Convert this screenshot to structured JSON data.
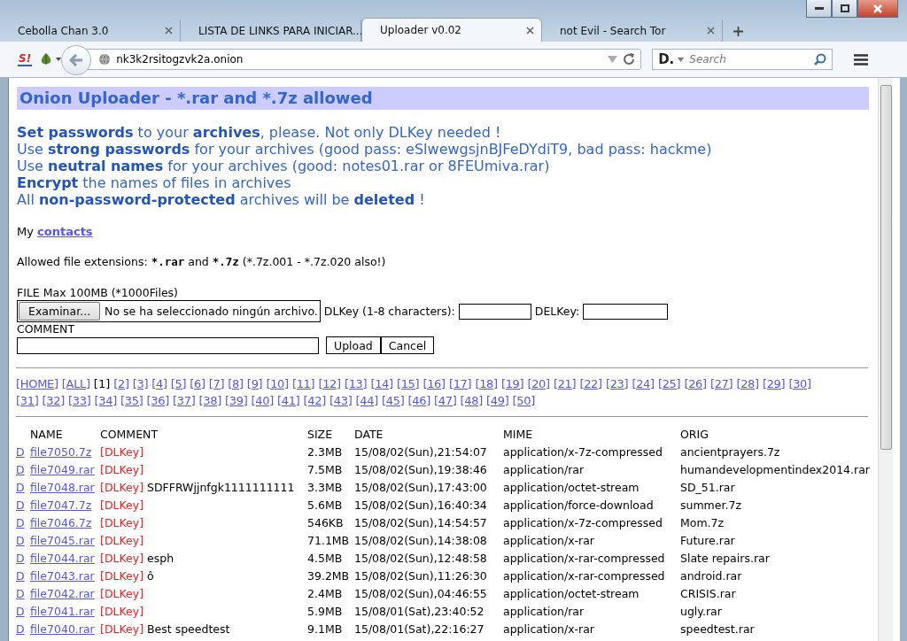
{
  "tabs": [
    {
      "label": "Cebolla Chan 3.0",
      "selected": false
    },
    {
      "label": "LISTA DE LINKS PARA INICIAR...",
      "selected": false
    },
    {
      "label": "Uploader v0.02",
      "selected": true
    },
    {
      "label": "not Evil - Search Tor",
      "selected": false
    }
  ],
  "toolbar": {
    "script_button": "S!",
    "url": "nk3k2rsitogzvk2a.onion",
    "search_engine": "D.",
    "search_placeholder": "Search"
  },
  "page": {
    "title": "Onion Uploader - *.rar and *.7z allowed",
    "notes": [
      "**Set passwords** to your **archives**, please. Not only DLKey needed !",
      "Use **strong passwords** for your archives (good pass: eSlwewgsjnBJFeDYdiT9, bad pass: hackme)",
      "Use **neutral names** for your archives (good: notes01.rar or 8FEUmiva.rar)",
      "**Encrypt** the names of files in archives",
      "All **non-password-protected** archives will be **deleted** !"
    ],
    "contacts": {
      "prefix": "My",
      "link": "contacts"
    },
    "extensions": [
      {
        "text": "Allowed file extensions: ",
        "bold": false
      },
      {
        "text": "*.rar",
        "bold": true
      },
      {
        "text": " and ",
        "bold": false
      },
      {
        "text": "*.7z",
        "bold": true
      },
      {
        "text": " (*.7z.001 - *.7z.020 also!)",
        "bold": false
      }
    ],
    "form": {
      "file_label": "FILE Max 100MB (*1000Files)",
      "browse_button": "Examinar...",
      "file_status": "No se ha seleccionado ningún archivo.",
      "dlkey_label": "DLKey (1-8 characters):",
      "delkey_label": "DELKey:",
      "comment_label": "COMMENT",
      "buttons": [
        "Upload",
        "Cancel"
      ]
    },
    "pager": [
      [
        {
          "label": "[HOME]",
          "selected": false
        },
        {
          "label": "[ALL]",
          "selected": false
        },
        {
          "label": "[1]",
          "selected": true
        },
        {
          "label": "[2]",
          "selected": false
        },
        {
          "label": "[3]",
          "selected": false
        },
        {
          "label": "[4]",
          "selected": false
        },
        {
          "label": "[5]",
          "selected": false
        },
        {
          "label": "[6]",
          "selected": false
        },
        {
          "label": "[7]",
          "selected": false
        },
        {
          "label": "[8]",
          "selected": false
        },
        {
          "label": "[9]",
          "selected": false
        },
        {
          "label": "[10]",
          "selected": false
        },
        {
          "label": "[11]",
          "selected": false
        },
        {
          "label": "[12]",
          "selected": false
        },
        {
          "label": "[13]",
          "selected": false
        },
        {
          "label": "[14]",
          "selected": false
        },
        {
          "label": "[15]",
          "selected": false
        },
        {
          "label": "[16]",
          "selected": false
        },
        {
          "label": "[17]",
          "selected": false
        },
        {
          "label": "[18]",
          "selected": false
        },
        {
          "label": "[19]",
          "selected": false
        },
        {
          "label": "[20]",
          "selected": false
        },
        {
          "label": "[21]",
          "selected": false
        },
        {
          "label": "[22]",
          "selected": false
        },
        {
          "label": "[23]",
          "selected": false
        },
        {
          "label": "[24]",
          "selected": false
        },
        {
          "label": "[25]",
          "selected": false
        },
        {
          "label": "[26]",
          "selected": false
        },
        {
          "label": "[27]",
          "selected": false
        },
        {
          "label": "[28]",
          "selected": false
        },
        {
          "label": "[29]",
          "selected": false
        },
        {
          "label": "[30]",
          "selected": false
        }
      ],
      [
        {
          "label": "[31]",
          "selected": false
        },
        {
          "label": "[32]",
          "selected": false
        },
        {
          "label": "[33]",
          "selected": false
        },
        {
          "label": "[34]",
          "selected": false
        },
        {
          "label": "[35]",
          "selected": false
        },
        {
          "label": "[36]",
          "selected": false
        },
        {
          "label": "[37]",
          "selected": false
        },
        {
          "label": "[38]",
          "selected": false
        },
        {
          "label": "[39]",
          "selected": false
        },
        {
          "label": "[40]",
          "selected": false
        },
        {
          "label": "[41]",
          "selected": false
        },
        {
          "label": "[42]",
          "selected": false
        },
        {
          "label": "[43]",
          "selected": false
        },
        {
          "label": "[44]",
          "selected": false
        },
        {
          "label": "[45]",
          "selected": false
        },
        {
          "label": "[46]",
          "selected": false
        },
        {
          "label": "[47]",
          "selected": false
        },
        {
          "label": "[48]",
          "selected": false
        },
        {
          "label": "[49]",
          "selected": false
        },
        {
          "label": "[50]",
          "selected": false
        }
      ]
    ],
    "table": {
      "columns": [
        "NAME",
        "COMMENT",
        "SIZE",
        "DATE",
        "MIME",
        "ORIG"
      ],
      "rows": [
        {
          "d": "D",
          "name": "file7050.7z",
          "key": "[DLKey]",
          "size": "2.3MB",
          "date": "15/08/02(Sun),21:54:07",
          "mime": "application/x-7z-compressed",
          "orig": "ancientprayers.7z"
        },
        {
          "d": "D",
          "name": "file7049.rar",
          "key": "[DLKey]",
          "size": "7.5MB",
          "date": "15/08/02(Sun),19:38:46",
          "mime": "application/rar",
          "orig": "humandevelopmentindex2014.rar"
        },
        {
          "d": "D",
          "name": "file7048.rar",
          "key": "[DLKey]",
          "comment": "SDFFRWjjnfgk1111111111",
          "size": "3.3MB",
          "date": "15/08/02(Sun),17:43:00",
          "mime": "application/octet-stream",
          "orig": "SD_51.rar"
        },
        {
          "d": "D",
          "name": "file7047.7z",
          "key": "[DLKey]",
          "size": "5.6MB",
          "date": "15/08/02(Sun),16:40:34",
          "mime": "application/force-download",
          "orig": "summer.7z"
        },
        {
          "d": "D",
          "name": "file7046.7z",
          "key": "[DLKey]",
          "size": "546KB",
          "date": "15/08/02(Sun),14:54:57",
          "mime": "application/x-7z-compressed",
          "orig": "Mom.7z"
        },
        {
          "d": "D",
          "name": "file7045.rar",
          "key": "[DLKey]",
          "size": "71.1MB",
          "date": "15/08/02(Sun),14:38:08",
          "mime": "application/x-rar",
          "orig": "Future.rar"
        },
        {
          "d": "D",
          "name": "file7044.rar",
          "key": "[DLKey]",
          "comment": "esph",
          "size": "4.5MB",
          "date": "15/08/02(Sun),12:48:58",
          "mime": "application/x-rar-compressed",
          "orig": "Slate repairs.rar"
        },
        {
          "d": "D",
          "name": "file7043.rar",
          "key": "[DLKey]",
          "comment": "ô",
          "size": "39.2MB",
          "date": "15/08/02(Sun),11:26:30",
          "mime": "application/x-rar-compressed",
          "orig": "android.rar"
        },
        {
          "d": "D",
          "name": "file7042.rar",
          "key": "[DLKey]",
          "size": "2.4MB",
          "date": "15/08/02(Sun),04:46:55",
          "mime": "application/octet-stream",
          "orig": "CRISIS.rar"
        },
        {
          "d": "D",
          "name": "file7041.rar",
          "key": "[DLKey]",
          "size": "5.9MB",
          "date": "15/08/01(Sat),23:40:52",
          "mime": "application/rar",
          "orig": "ugly.rar"
        },
        {
          "d": "D",
          "name": "file7040.rar",
          "key": "[DLKey]",
          "comment": "Best speedtest",
          "size": "9.1MB",
          "date": "15/08/01(Sat),22:16:27",
          "mime": "application/x-rar",
          "orig": "speedtest.rar"
        }
      ]
    }
  }
}
